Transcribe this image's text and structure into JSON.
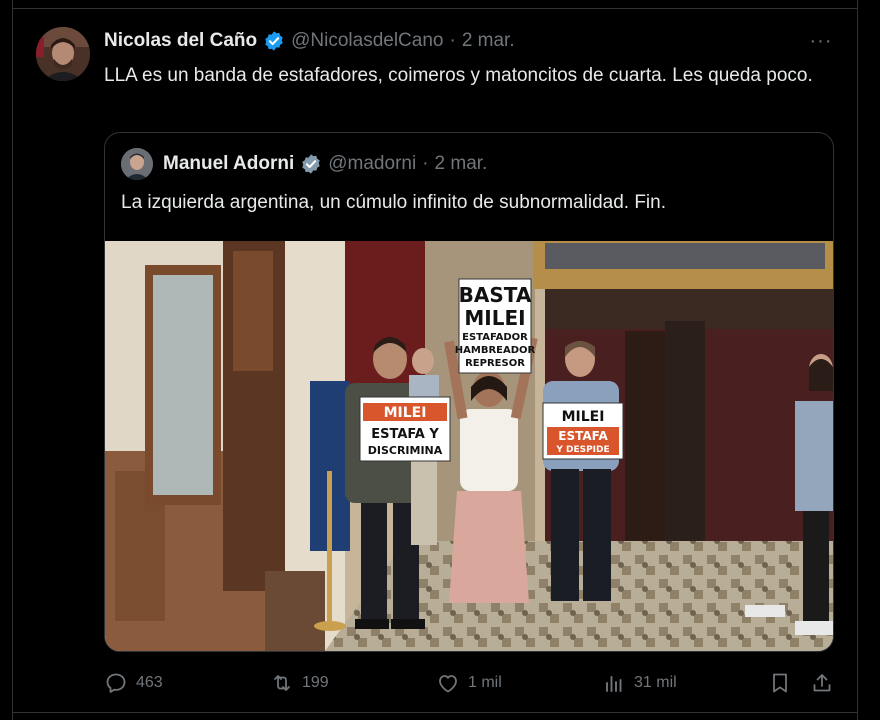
{
  "tweet": {
    "author_name": "Nicolas del Caño",
    "author_handle": "@NicolasdelCano",
    "separator": "·",
    "date": "2 mar.",
    "more_label": "···",
    "text": "LLA es un banda de estafadores, coimeros y matoncitos de cuarta. Les queda poco."
  },
  "quoted": {
    "author_name": "Manuel Adorni",
    "author_handle": "@madorni",
    "separator": "·",
    "date": "2 mar.",
    "text": "La izquierda argentina, un cúmulo infinito de subnormalidad. Fin.",
    "photo": {
      "signs": {
        "center_top": "BASTA",
        "center_mid": "MILEI",
        "center_line1": "ESTAFADOR",
        "center_line2": "HAMBREADOR",
        "center_line3": "REPRESOR",
        "left_top": "MILEI",
        "left_band": "ESTAFA Y",
        "left_bottom": "DISCRIMINA",
        "right_top": "MILEI",
        "right_band": "ESTAFA",
        "right_band2": "Y DESPIDE"
      }
    }
  },
  "actions": {
    "replies": "463",
    "reposts": "199",
    "likes": "1 mil",
    "views": "31 mil"
  },
  "colors": {
    "background": "#000000",
    "text_primary": "#e7e9ea",
    "text_secondary": "#71767b",
    "verified_blue": "#1d9bf0",
    "verified_gray": "#829aab",
    "border": "#2f3336"
  },
  "icons": {
    "reply": "reply-icon",
    "repost": "repost-icon",
    "like": "heart-icon",
    "views": "views-icon",
    "bookmark": "bookmark-icon",
    "share": "share-icon",
    "verified": "verified-badge-icon",
    "more": "more-icon"
  }
}
